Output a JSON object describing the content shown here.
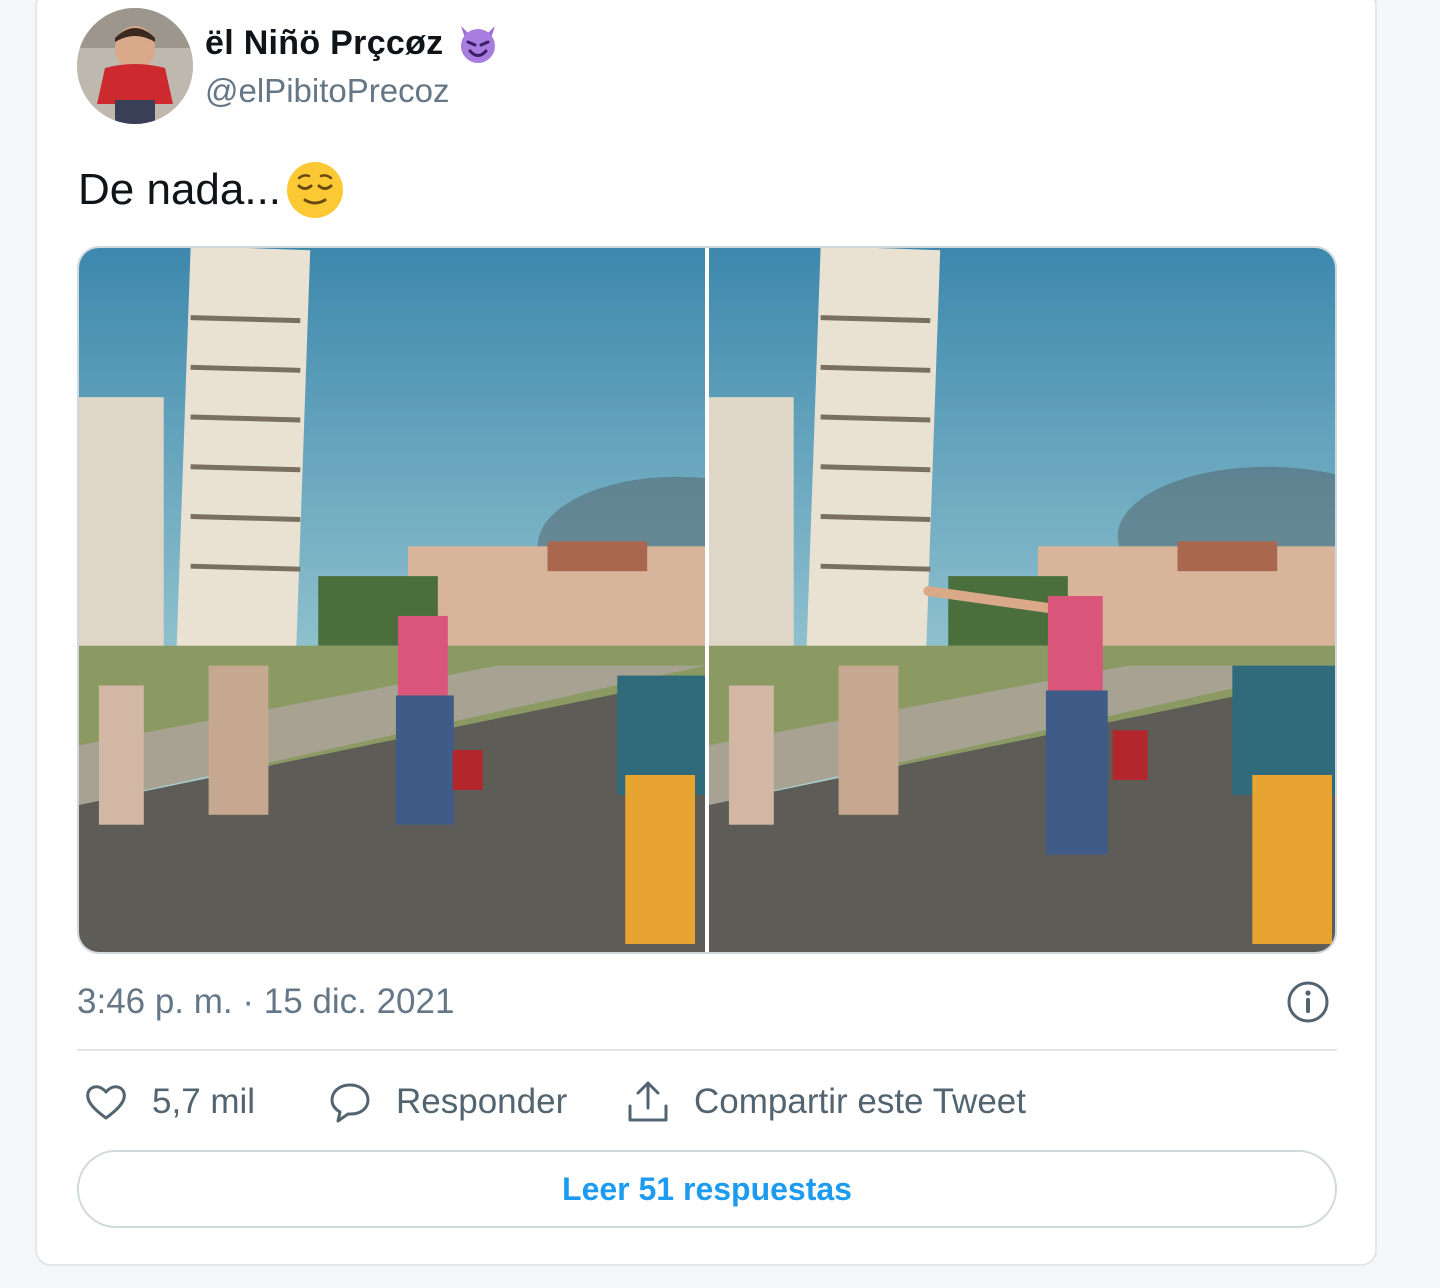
{
  "tweet": {
    "author": {
      "name": "ël Niñö Prçcøz",
      "handle": "@elPibitoPrecoz",
      "name_emoji": "smiling-face-with-horns-icon"
    },
    "text": "De nada...",
    "text_emoji": "relieved-face-icon",
    "media": [
      {
        "kind": "photo",
        "subject": "leaning-tower-photo"
      },
      {
        "kind": "photo",
        "subject": "leaning-tower-photo"
      }
    ],
    "timestamp": "3:46 p. m. · 15 dic. 2021",
    "actions": {
      "like_count": "5,7 mil",
      "reply_label": "Responder",
      "share_label": "Compartir este Tweet"
    },
    "read_replies_label": "Leer 51 respuestas"
  },
  "colors": {
    "link_blue": "#1d9bf0",
    "muted_text": "#657786",
    "border": "#cfd9de"
  }
}
